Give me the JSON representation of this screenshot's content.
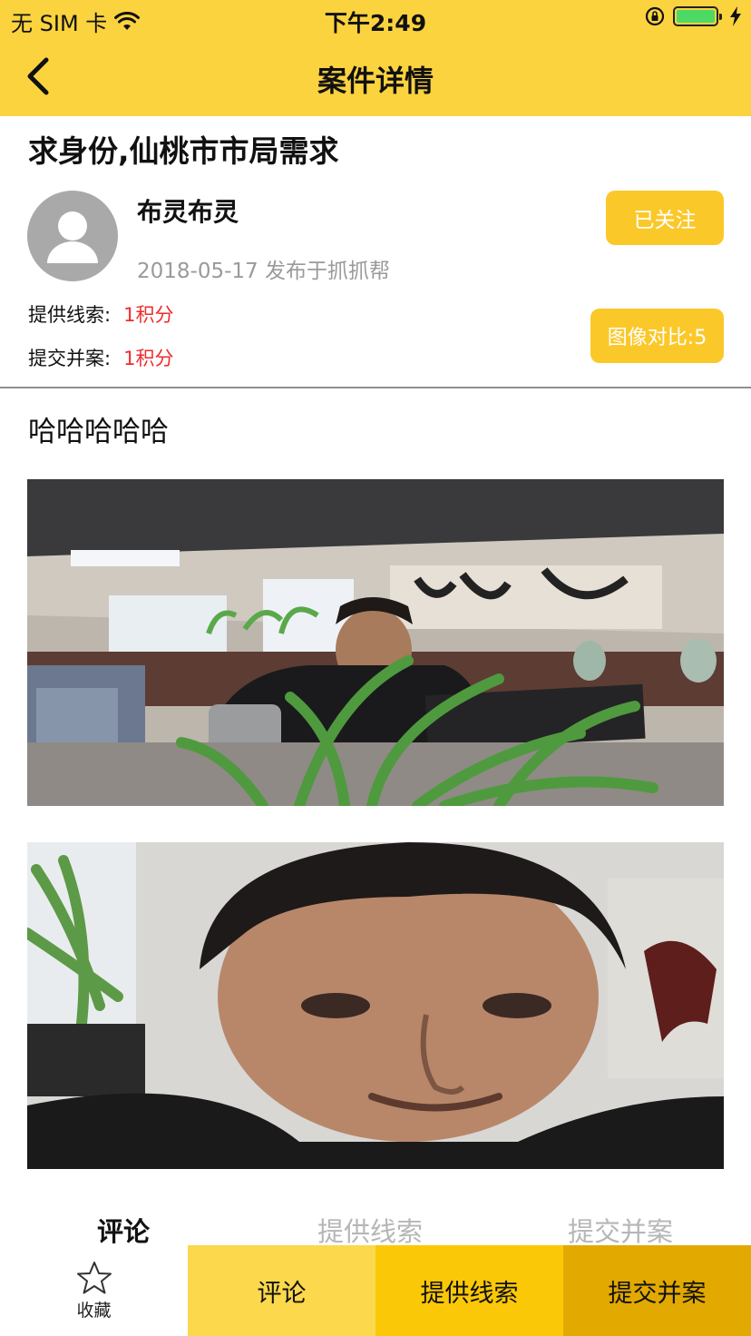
{
  "status_bar": {
    "carrier": "无 SIM 卡",
    "time": "下午2:49"
  },
  "nav": {
    "title": "案件详情"
  },
  "case": {
    "title": "求身份,仙桃市市局需求",
    "author": "布灵布灵",
    "publish_info": "2018-05-17 发布于抓抓帮",
    "follow_label": "已关注",
    "compare_label": "图像对比:5",
    "rewards": [
      {
        "label": "提供线索:",
        "value": "1积分"
      },
      {
        "label": "提交并案:",
        "value": "1积分"
      }
    ],
    "description": "哈哈哈哈哈"
  },
  "tabs": [
    {
      "label": "评论",
      "active": true
    },
    {
      "label": "提供线索",
      "active": false
    },
    {
      "label": "提交并案",
      "active": false
    }
  ],
  "bottom": {
    "favorite_label": "收藏",
    "comment_label": "评论",
    "clue_label": "提供线索",
    "merge_label": "提交并案"
  },
  "colors": {
    "brand_yellow": "#fbd33f",
    "button_yellow": "#fbc82a",
    "reward_red": "#ee2b2b"
  }
}
